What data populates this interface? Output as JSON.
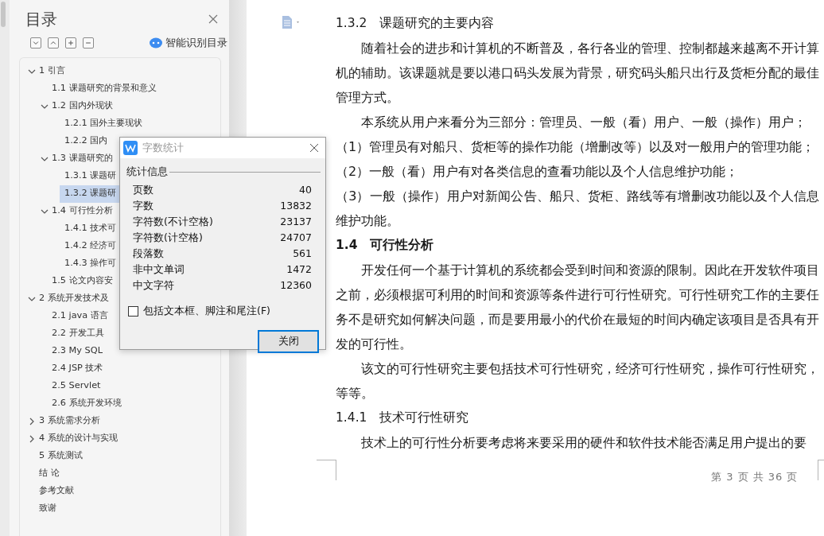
{
  "sidebar": {
    "title": "目录",
    "smart_toc_label": "智能识别目录",
    "toc": [
      {
        "label": "1 引言",
        "expanded": true,
        "selected": false,
        "children": [
          {
            "label": "1.1 课题研究的背景和意义",
            "selected": false
          },
          {
            "label": "1.2 国内外现状",
            "expanded": true,
            "selected": false,
            "children": [
              {
                "label": "1.2.1 国外主要现状",
                "selected": false
              },
              {
                "label": "1.2.2 国内",
                "selected": false
              }
            ]
          },
          {
            "label": "1.3 课题研究的",
            "expanded": true,
            "selected": false,
            "children": [
              {
                "label": "1.3.1 课题研",
                "selected": false
              },
              {
                "label": "1.3.2 课题研",
                "selected": true
              }
            ]
          },
          {
            "label": "1.4 可行性分析",
            "expanded": true,
            "selected": false,
            "children": [
              {
                "label": "1.4.1 技术可",
                "selected": false
              },
              {
                "label": "1.4.2 经济可",
                "selected": false
              },
              {
                "label": "1.4.3 操作可",
                "selected": false
              }
            ]
          },
          {
            "label": "1.5 论文内容安",
            "selected": false
          }
        ]
      },
      {
        "label": "2 系统开发技术及",
        "expanded": true,
        "selected": false,
        "children": [
          {
            "label": "2.1 java 语言",
            "selected": false
          },
          {
            "label": "2.2 开发工具",
            "selected": false
          },
          {
            "label": "2.3 My SQL",
            "selected": false
          },
          {
            "label": "2.4 JSP 技术",
            "selected": false
          },
          {
            "label": "2.5 Servlet",
            "selected": false
          },
          {
            "label": "2.6 系统开发环境",
            "selected": false
          }
        ]
      },
      {
        "label": "3 系统需求分析",
        "expanded": false,
        "selected": false
      },
      {
        "label": "4 系统的设计与实现",
        "expanded": false,
        "selected": false
      },
      {
        "label": "5 系统测试",
        "selected": false
      },
      {
        "label": "结 论",
        "selected": false
      },
      {
        "label": "参考文献",
        "selected": false
      },
      {
        "label": "致谢",
        "selected": false
      }
    ]
  },
  "document": {
    "blocks": [
      {
        "kind": "heading3",
        "text": "1.3.2　课题研究的主要内容"
      },
      {
        "kind": "paragraph",
        "text": "随着社会的进步和计算机的不断普及，各行各业的管理、控制都越来越离不开计算机的辅助。该课题就是要以港口码头发展为背景，研究码头船只出行及货柜分配的最佳管理方式。"
      },
      {
        "kind": "paragraph",
        "text": "本系统从用户来看分为三部分：管理员、一般（看）用户、一般（操作）用户；"
      },
      {
        "kind": "list_item",
        "text": "（1）管理员有对船只、货柜等的操作功能（增删改等）以及对一般用户的管理功能；"
      },
      {
        "kind": "list_item",
        "text": "（2）一般（看）用户有对各类信息的查看功能以及个人信息维护功能；"
      },
      {
        "kind": "list_item",
        "text": "（3）一般（操作）用户对新闻公告、船只、货柜、路线等有增删改功能以及个人信息维护功能。"
      },
      {
        "kind": "heading2",
        "text": "1.4　可行性分析"
      },
      {
        "kind": "paragraph",
        "text": "开发任何一个基于计算机的系统都会受到时间和资源的限制。因此在开发软件项目之前，必须根据可利用的时间和资源等条件进行可行性研究。可行性研究工作的主要任务不是研究如何解决问题，而是要用最小的代价在最短的时间内确定该项目是否具有开发的可行性。"
      },
      {
        "kind": "paragraph",
        "text": "该文的可行性研究主要包括技术可行性研究，经济可行性研究，操作可行性研究，等等。"
      },
      {
        "kind": "heading3",
        "text": "1.4.1　技术可行性研究"
      },
      {
        "kind": "paragraph",
        "text": "技术上的可行性分析要考虑将来要采用的硬件和软件技术能否满足用户提出的要"
      }
    ],
    "page_footer": "第 3 页 共 36 页"
  },
  "dialog": {
    "title": "字数统计",
    "group_label": "统计信息",
    "stats": [
      {
        "label": "页数",
        "value": "40"
      },
      {
        "label": "字数",
        "value": "13832"
      },
      {
        "label": "字符数(不计空格)",
        "value": "23137"
      },
      {
        "label": "字符数(计空格)",
        "value": "24707"
      },
      {
        "label": "段落数",
        "value": "561"
      },
      {
        "label": "非中文单词",
        "value": "1472"
      },
      {
        "label": "中文字符",
        "value": "12360"
      }
    ],
    "include_option": {
      "label": "包括文本框、脚注和尾注(F)",
      "checked": false
    },
    "close_button": "关闭"
  }
}
